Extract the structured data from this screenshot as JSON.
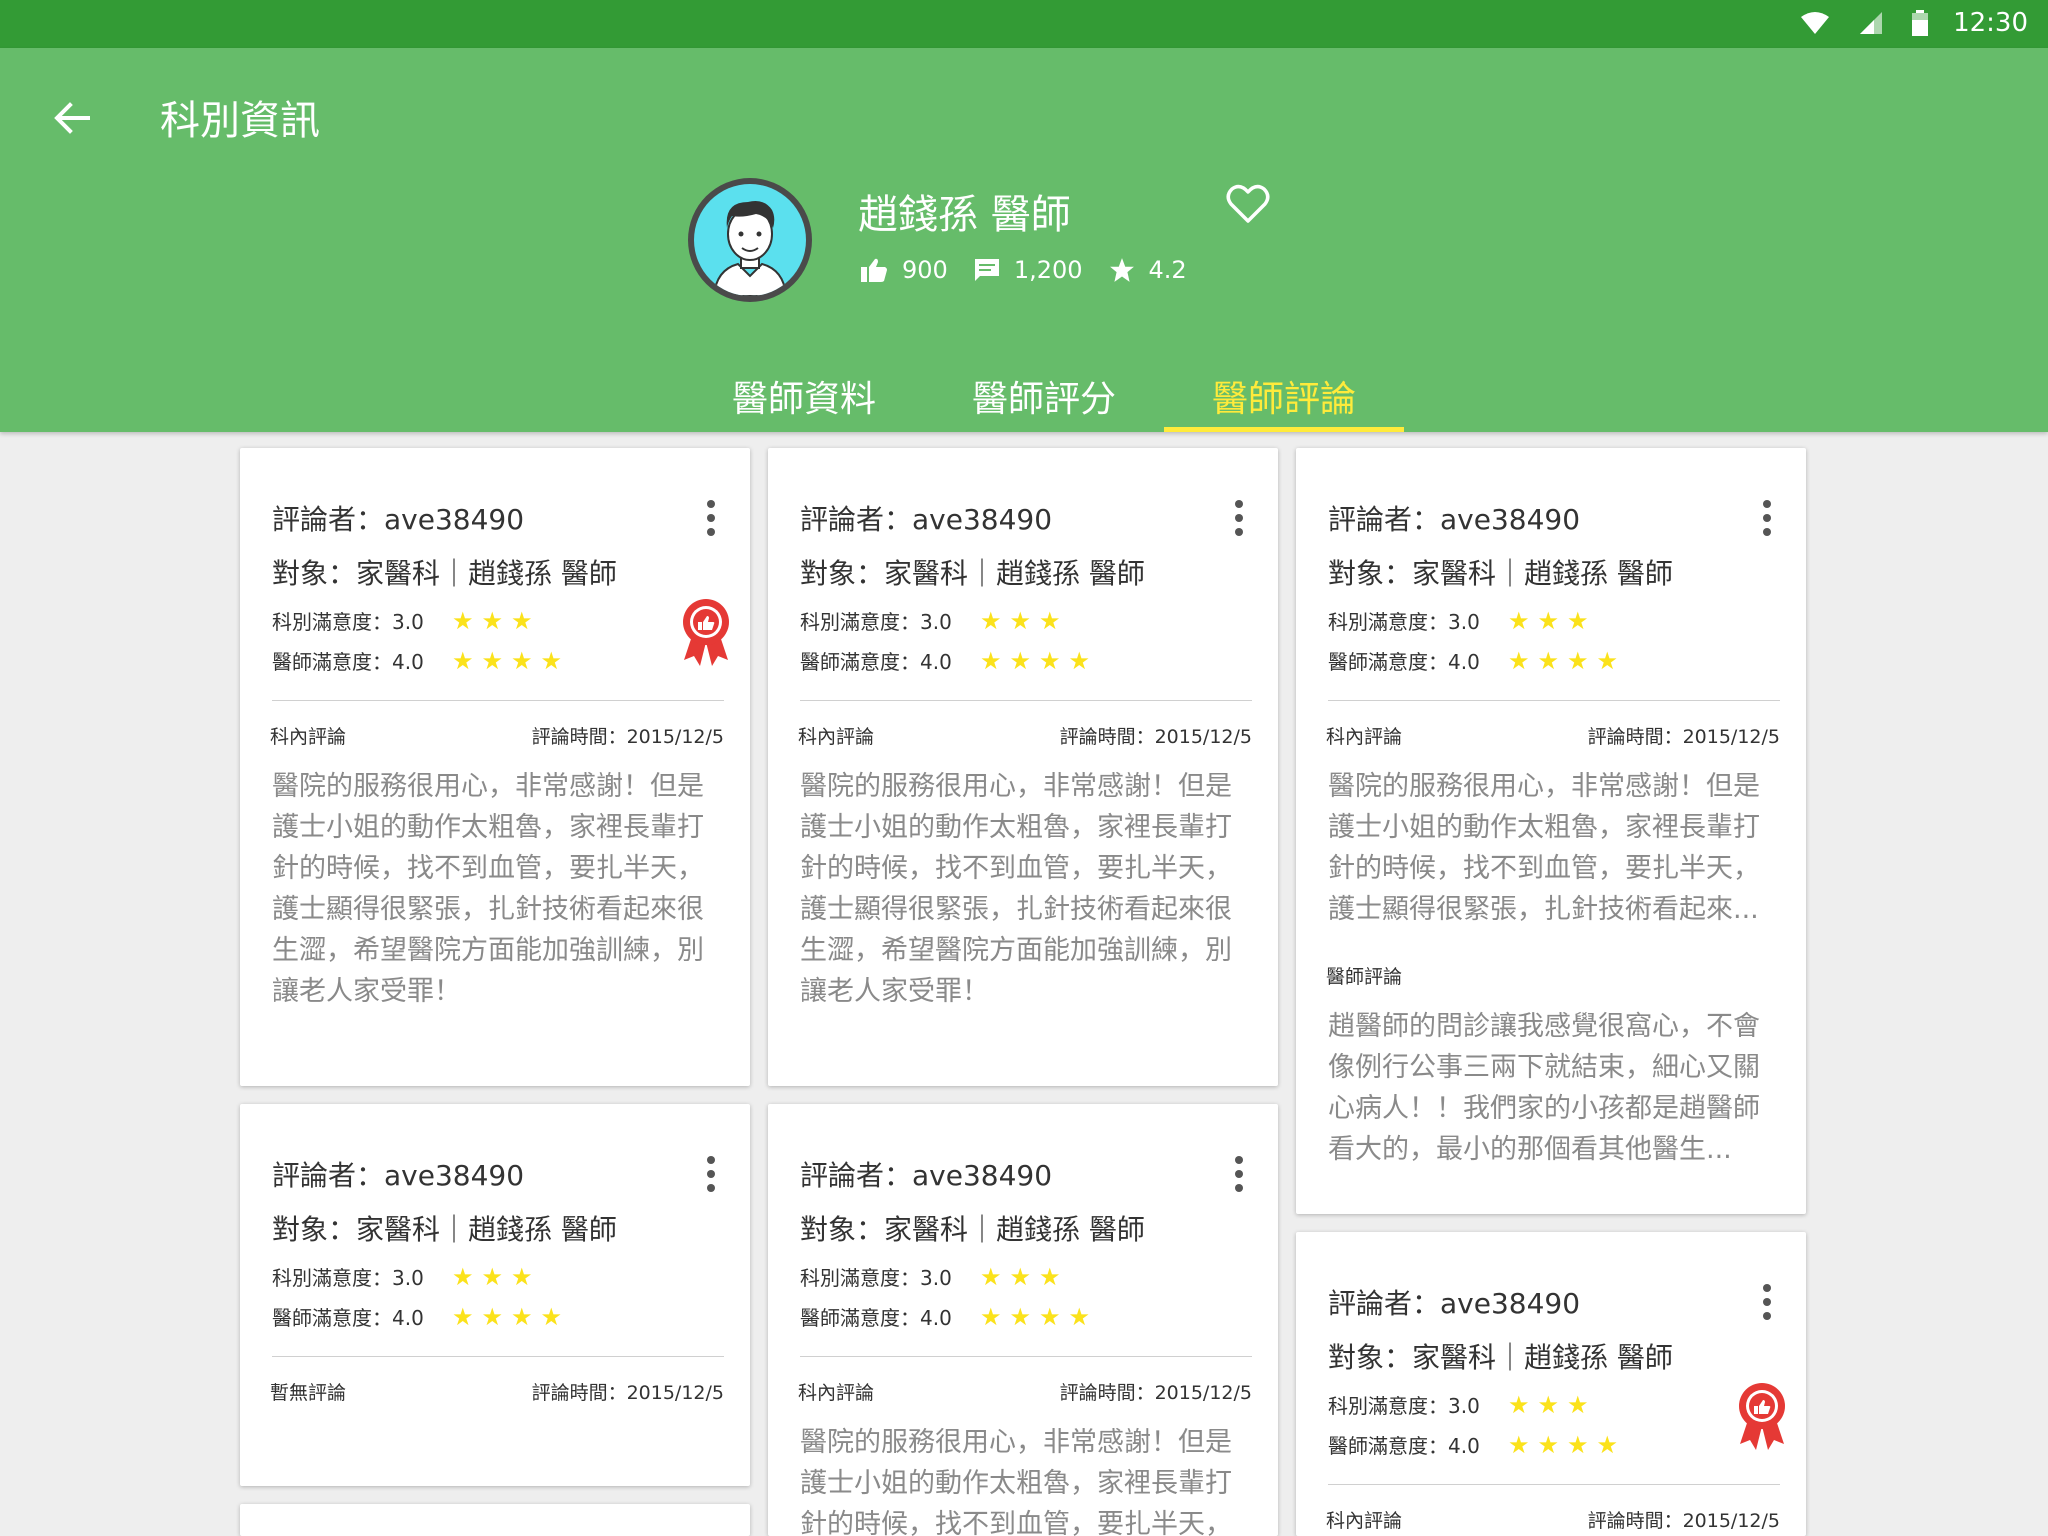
{
  "status_bar": {
    "time": "12:30"
  },
  "app_bar": {
    "title": "科別資訊"
  },
  "doctor": {
    "name": "趙錢孫 醫師",
    "likes": "900",
    "comments": "1,200",
    "rating": "4.2"
  },
  "tabs": [
    {
      "label": "醫師資料",
      "active": false
    },
    {
      "label": "醫師評分",
      "active": false
    },
    {
      "label": "醫師評論",
      "active": true
    }
  ],
  "colors": {
    "primary": "#66bc6a",
    "status_bar": "#339b35",
    "accent": "#ffeb3b",
    "star": "#fbe21b",
    "badge": "#e53935"
  },
  "cards": [
    {
      "reviewer": "評論者：ave38490",
      "target": "對象：家醫科｜趙錢孫 醫師",
      "dept_rating_label": "科別滿意度：3.0",
      "dept_stars": 3,
      "doc_rating_label": "醫師滿意度：4.0",
      "doc_stars": 4,
      "badge": true,
      "section1": "科內評論",
      "time": "評論時間：2015/12/5",
      "body1": "醫院的服務很用心，非常感謝！但是護士小姐的動作太粗魯，家裡長輩打針的時候，找不到血管，要扎半天，護士顯得很緊張，扎針技術看起來很生澀，希望醫院方面能加強訓練，別讓老人家受罪！"
    },
    {
      "reviewer": "評論者：ave38490",
      "target": "對象：家醫科｜趙錢孫 醫師",
      "dept_rating_label": "科別滿意度：3.0",
      "dept_stars": 3,
      "doc_rating_label": "醫師滿意度：4.0",
      "doc_stars": 4,
      "badge": false,
      "section1": "科內評論",
      "time": "評論時間：2015/12/5",
      "body1": "醫院的服務很用心，非常感謝！但是護士小姐的動作太粗魯，家裡長輩打針的時候，找不到血管，要扎半天，護士顯得很緊張，扎針技術看起來很生澀，希望醫院方面能加強訓練，別讓老人家受罪！"
    },
    {
      "reviewer": "評論者：ave38490",
      "target": "對象：家醫科｜趙錢孫 醫師",
      "dept_rating_label": "科別滿意度：3.0",
      "dept_stars": 3,
      "doc_rating_label": "醫師滿意度：4.0",
      "doc_stars": 4,
      "badge": false,
      "section1": "科內評論",
      "time": "評論時間：2015/12/5",
      "body1": "醫院的服務很用心，非常感謝！但是護士小姐的動作太粗魯，家裡長輩打針的時候，找不到血管，要扎半天，護士顯得很緊張，扎針技術看起來...",
      "section2": "醫師評論",
      "body2": "趙醫師的問診讓我感覺很窩心，不會像例行公事三兩下就結束，細心又關心病人！！我們家的小孩都是趙醫師看大的，最小的那個看其他醫生..."
    },
    {
      "reviewer": "評論者：ave38490",
      "target": "對象：家醫科｜趙錢孫 醫師",
      "dept_rating_label": "科別滿意度：3.0",
      "dept_stars": 3,
      "doc_rating_label": "醫師滿意度：4.0",
      "doc_stars": 4,
      "badge": false,
      "section1": "暫無評論",
      "time": "評論時間：2015/12/5"
    },
    {
      "reviewer": "評論者：ave38490",
      "target": "對象：家醫科｜趙錢孫 醫師",
      "dept_rating_label": "科別滿意度：3.0",
      "dept_stars": 3,
      "doc_rating_label": "醫師滿意度：4.0",
      "doc_stars": 4,
      "badge": false,
      "section1": "科內評論",
      "time": "評論時間：2015/12/5",
      "body1": "醫院的服務很用心，非常感謝！但是護士小姐的動作太粗魯，家裡長輩打針的時候，找不到血管，要扎半天，"
    },
    {
      "reviewer": "評論者：ave38490",
      "target": "對象：家醫科｜趙錢孫 醫師",
      "dept_rating_label": "科別滿意度：3.0",
      "dept_stars": 3,
      "doc_rating_label": "醫師滿意度：4.0",
      "doc_stars": 4,
      "badge": true,
      "section1": "科內評論",
      "time": "評論時間：2015/12/5"
    }
  ]
}
